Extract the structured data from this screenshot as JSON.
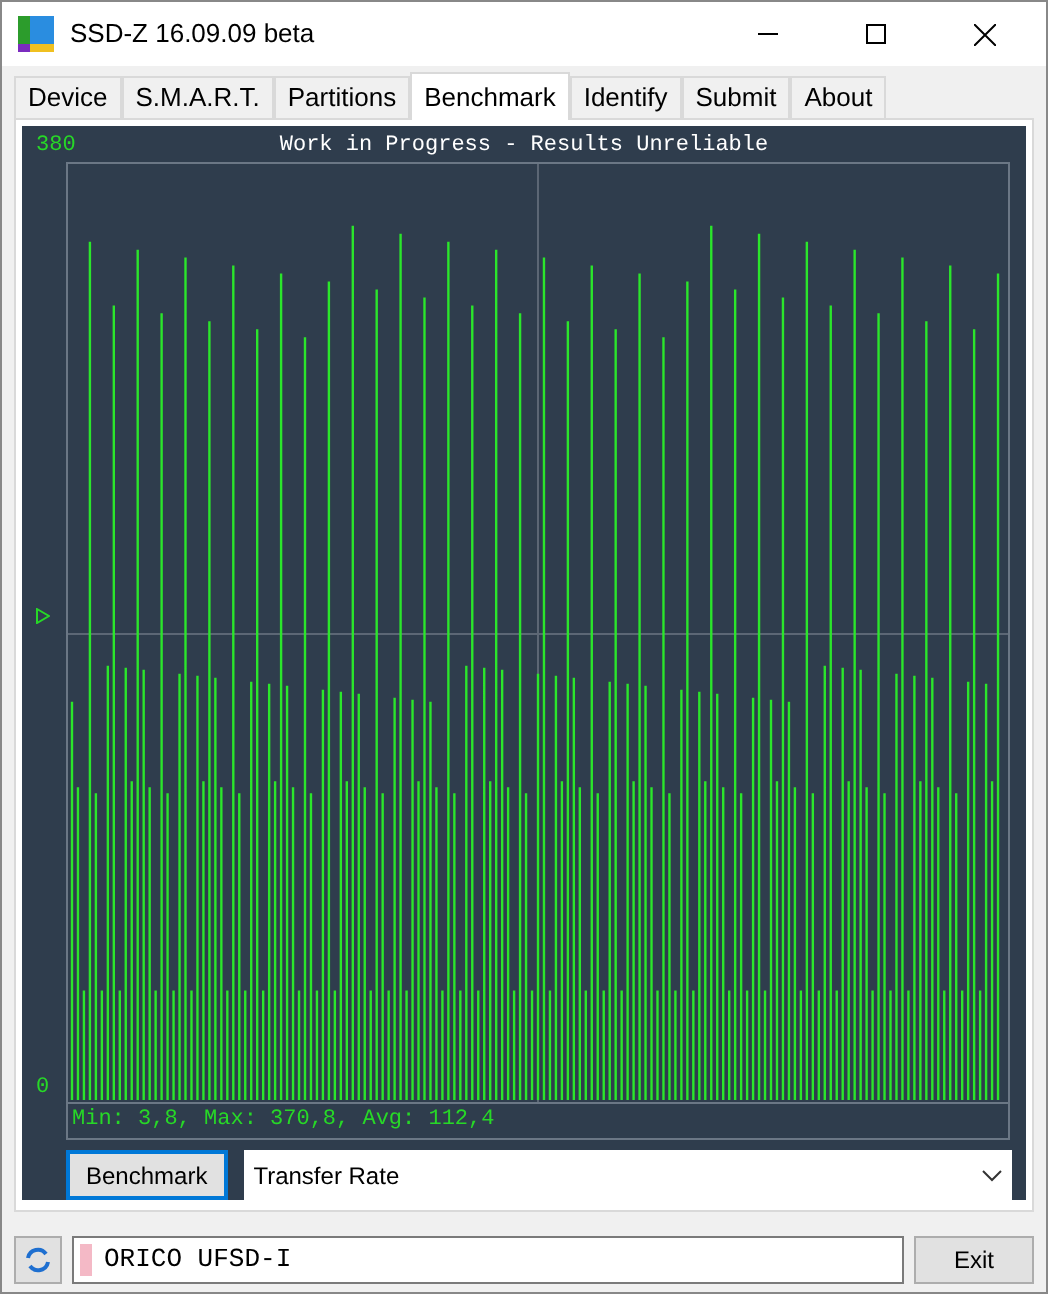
{
  "window": {
    "title": "SSD-Z 16.09.09 beta"
  },
  "tabs": [
    {
      "label": "Device",
      "selected": false
    },
    {
      "label": "S.M.A.R.T.",
      "selected": false
    },
    {
      "label": "Partitions",
      "selected": false
    },
    {
      "label": "Benchmark",
      "selected": true
    },
    {
      "label": "Identify",
      "selected": false
    },
    {
      "label": "Submit",
      "selected": false
    },
    {
      "label": "About",
      "selected": false
    }
  ],
  "graph": {
    "title": "Work in Progress - Results Unreliable",
    "y_max": "380",
    "y_min": "0",
    "stats": "Min: 3,8, Max: 370,8, Avg: 112,4"
  },
  "controls": {
    "button": "Benchmark",
    "mode": "Transfer Rate"
  },
  "status_bar": {
    "drive": "ORICO UFSD-I",
    "button": "Exit"
  }
}
